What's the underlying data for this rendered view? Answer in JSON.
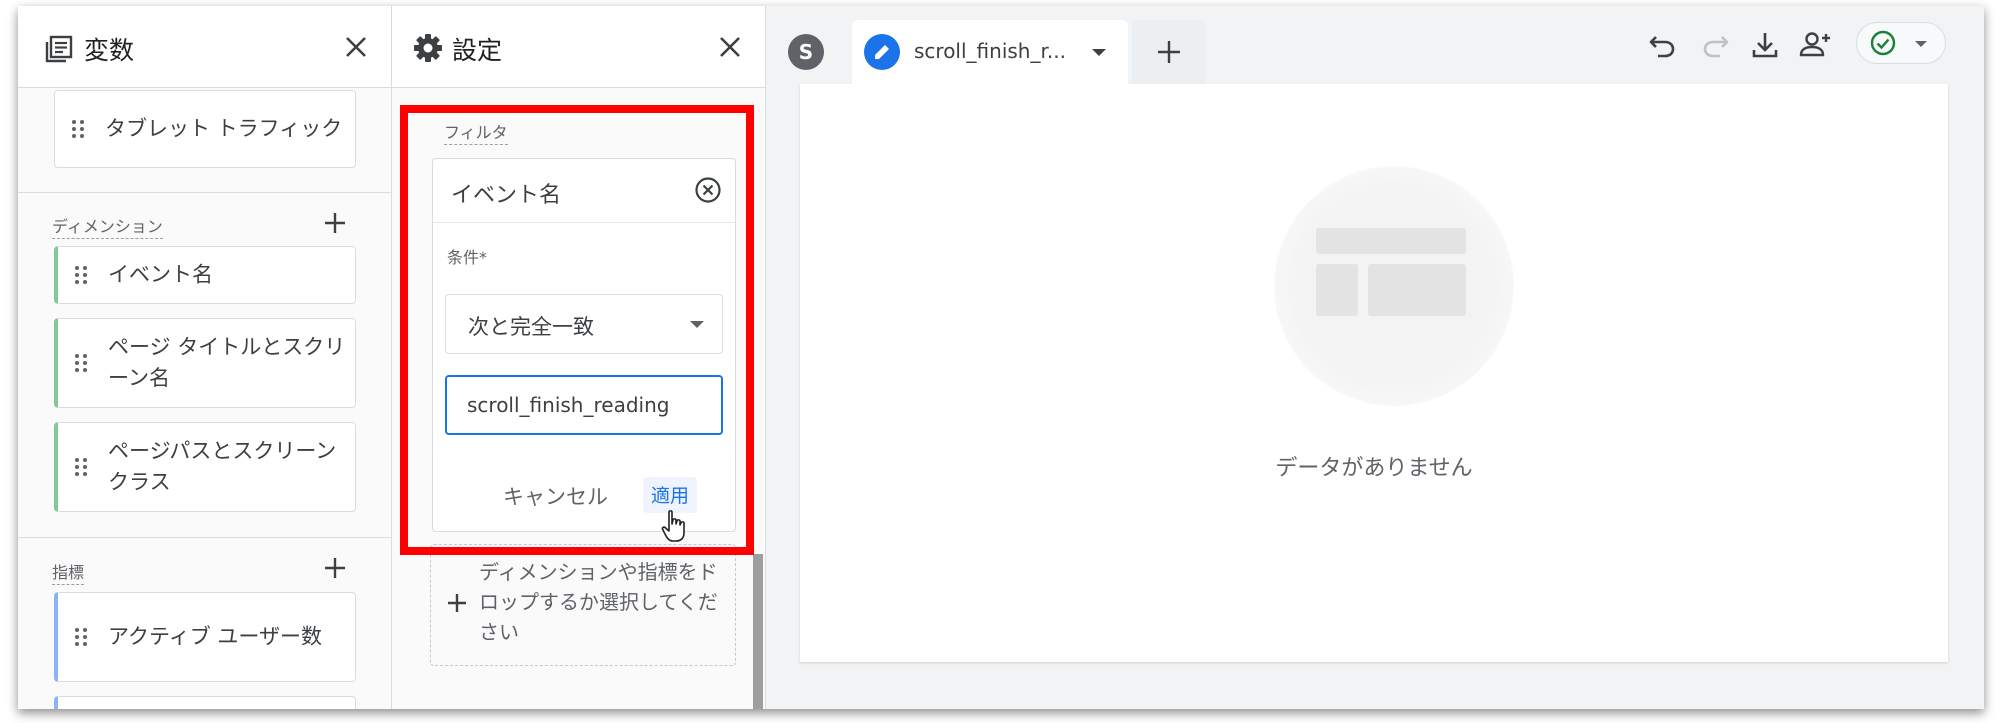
{
  "variables_panel": {
    "title": "変数",
    "chips_top": [
      {
        "label": "タブレット トラフィック"
      }
    ],
    "dimensions": {
      "label": "ディメンション",
      "items": [
        "イベント名",
        "ページ タイトルとスクリーン名",
        "ページパスとスクリーン クラス"
      ]
    },
    "metrics": {
      "label": "指標",
      "items": [
        "アクティブ ユーザー数"
      ]
    },
    "colors": {
      "dimension_accent": "#81c995",
      "metric_accent": "#8ab4f8"
    }
  },
  "settings_panel": {
    "title": "設定",
    "filter": {
      "label": "フィルタ",
      "field_name": "イベント名",
      "condition_label": "条件*",
      "condition_value": "次と完全一致",
      "value": "scroll_finish_reading",
      "cancel_label": "キャンセル",
      "apply_label": "適用"
    },
    "drop_zone_text": "ディメンションや指標をドロップするか選択してください",
    "highlight_color": "#ff0000"
  },
  "tabs": {
    "avatar_letter": "S",
    "active_tab_name": "scroll_finish_r..."
  },
  "toolbar": {
    "icons": [
      "undo-icon",
      "redo-icon",
      "download-icon",
      "share-user-icon",
      "check-circle-icon"
    ]
  },
  "canvas": {
    "empty_message": "データがありません"
  }
}
